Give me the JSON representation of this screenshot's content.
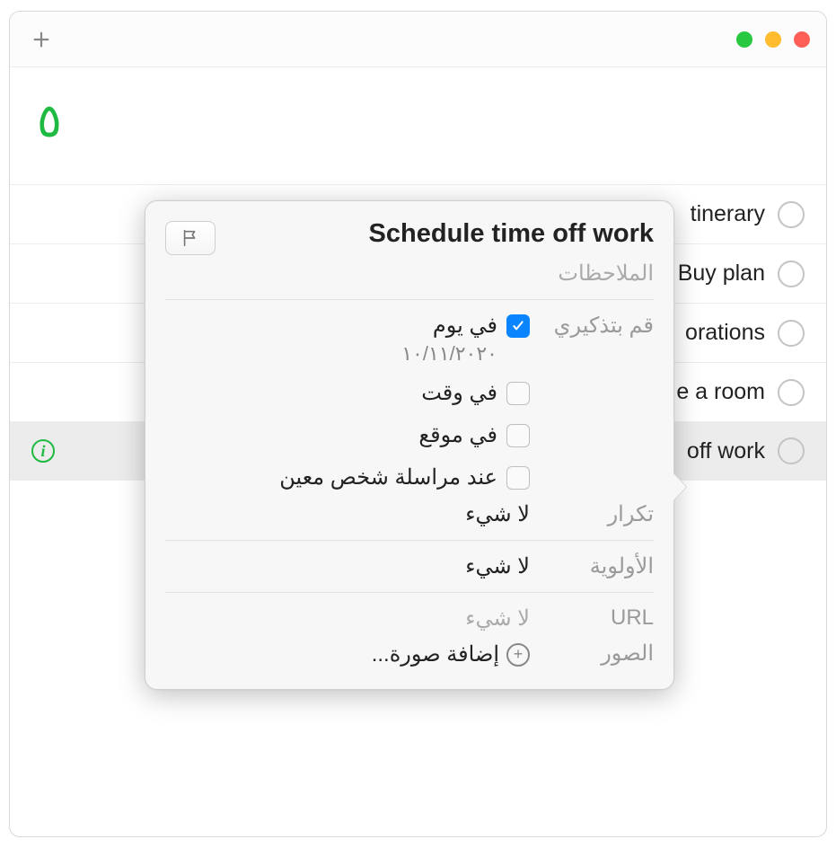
{
  "header": {
    "count": "٥"
  },
  "list": {
    "items": [
      {
        "label": "tinerary"
      },
      {
        "label": "Buy plan"
      },
      {
        "label": "orations"
      },
      {
        "label": "e a room"
      },
      {
        "label": "off work"
      }
    ]
  },
  "popover": {
    "title": "Schedule time off work",
    "notes_placeholder": "الملاحظات",
    "remind_label": "قم بتذكيري",
    "on_day": {
      "label": "في يوم",
      "checked": true,
      "date": "١٠/١١/٢٠٢٠"
    },
    "at_time": {
      "label": "في وقت",
      "checked": false
    },
    "at_location": {
      "label": "في موقع",
      "checked": false
    },
    "when_messaging": {
      "label": "عند مراسلة شخص معين",
      "checked": false
    },
    "repeat": {
      "label": "تكرار",
      "value": "لا شيء"
    },
    "priority": {
      "label": "الأولوية",
      "value": "لا شيء"
    },
    "url": {
      "label": "URL",
      "placeholder": "لا شيء"
    },
    "images": {
      "label": "الصور",
      "add_label": "إضافة صورة..."
    }
  }
}
